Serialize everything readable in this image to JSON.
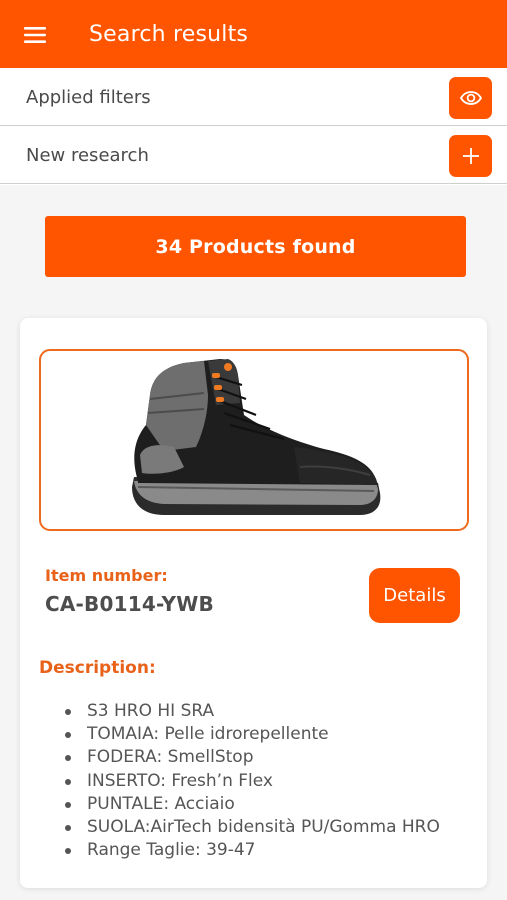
{
  "header": {
    "title": "Search results",
    "menu_icon": "hamburger-menu-icon"
  },
  "filters": {
    "applied_label": "Applied filters",
    "applied_icon": "eye-icon",
    "new_research_label": "New research",
    "new_research_icon": "plus-icon"
  },
  "results": {
    "found_label": "34 Products found"
  },
  "product": {
    "image_icon": "safety-boot-image",
    "item_number_label": "Item number:",
    "item_number": "CA-B0114-YWB",
    "details_label": "Details",
    "description_label": "Description:",
    "description_items": [
      "S3 HRO HI SRA",
      "TOMAIA: Pelle idrorepellente",
      "FODERA: SmellStop",
      "INSERTO: Fresh’n Flex",
      "PUNTALE: Acciaio",
      "SUOLA:AirTech bidensità PU/Gomma HRO",
      "Range Taglie: 39-47"
    ]
  },
  "colors": {
    "brand": "#ff5500",
    "label_orange": "#e9621a",
    "text_dark": "#4d4d4d"
  }
}
